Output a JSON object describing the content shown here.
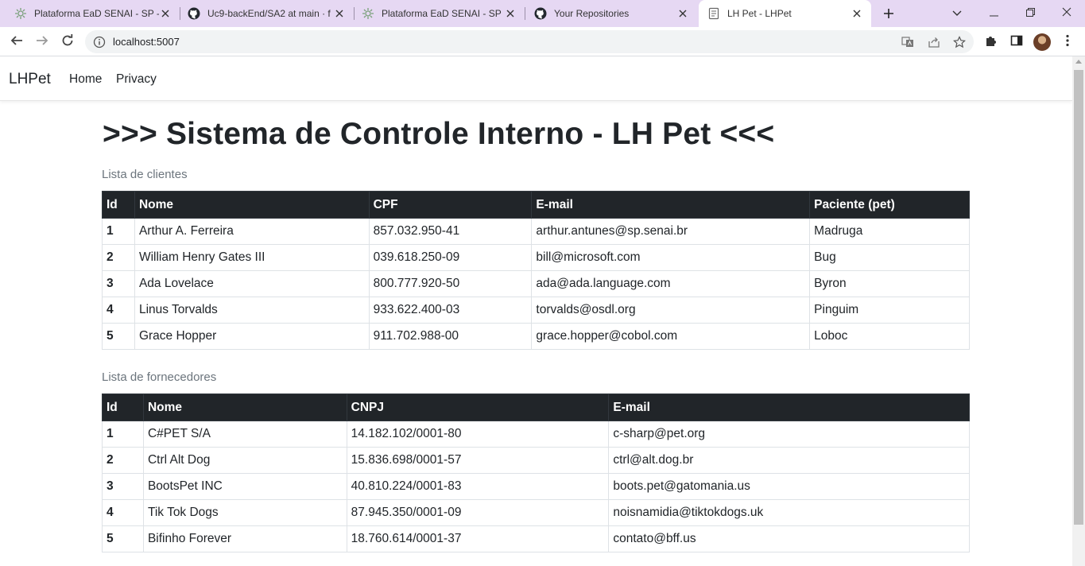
{
  "browser": {
    "tabs": [
      {
        "title": "Plataforma EaD SENAI - SP -",
        "icon": "senai-favicon"
      },
      {
        "title": "Uc9-backEnd/SA2 at main · f",
        "icon": "github-favicon"
      },
      {
        "title": "Plataforma EaD SENAI - SP -",
        "icon": "senai-favicon"
      },
      {
        "title": "Your Repositories",
        "icon": "github-favicon"
      },
      {
        "title": "LH Pet - LHPet",
        "icon": "page-favicon",
        "active": true
      }
    ],
    "address": "localhost:5007"
  },
  "site": {
    "brand": "LHPet",
    "nav": [
      "Home",
      "Privacy"
    ]
  },
  "page": {
    "heading": ">>> Sistema de Controle Interno - LH Pet <<<",
    "clients": {
      "caption": "Lista de clientes",
      "headers": [
        "Id",
        "Nome",
        "CPF",
        "E-mail",
        "Paciente (pet)"
      ],
      "rows": [
        [
          "1",
          "Arthur A. Ferreira",
          "857.032.950-41",
          "arthur.antunes@sp.senai.br",
          "Madruga"
        ],
        [
          "2",
          "William Henry Gates III",
          "039.618.250-09",
          "bill@microsoft.com",
          "Bug"
        ],
        [
          "3",
          "Ada Lovelace",
          "800.777.920-50",
          "ada@ada.language.com",
          "Byron"
        ],
        [
          "4",
          "Linus Torvalds",
          "933.622.400-03",
          "torvalds@osdl.org",
          "Pinguim"
        ],
        [
          "5",
          "Grace Hopper",
          "911.702.988-00",
          "grace.hopper@cobol.com",
          "Loboc"
        ]
      ]
    },
    "suppliers": {
      "caption": "Lista de fornecedores",
      "headers": [
        "Id",
        "Nome",
        "CNPJ",
        "E-mail"
      ],
      "rows": [
        [
          "1",
          "C#PET S/A",
          "14.182.102/0001-80",
          "c-sharp@pet.org"
        ],
        [
          "2",
          "Ctrl Alt Dog",
          "15.836.698/0001-57",
          "ctrl@alt.dog.br"
        ],
        [
          "3",
          "BootsPet INC",
          "40.810.224/0001-83",
          "boots.pet@gatomania.us"
        ],
        [
          "4",
          "Tik Tok Dogs",
          "87.945.350/0001-09",
          "noisnamidia@tiktokdogs.uk"
        ],
        [
          "5",
          "Bifinho Forever",
          "18.760.614/0001-37",
          "contato@bff.us"
        ]
      ]
    }
  },
  "colors": {
    "tabbar_bg": "#e6d8f3",
    "table_header_bg": "#212529",
    "caption_text": "#6c757d"
  }
}
